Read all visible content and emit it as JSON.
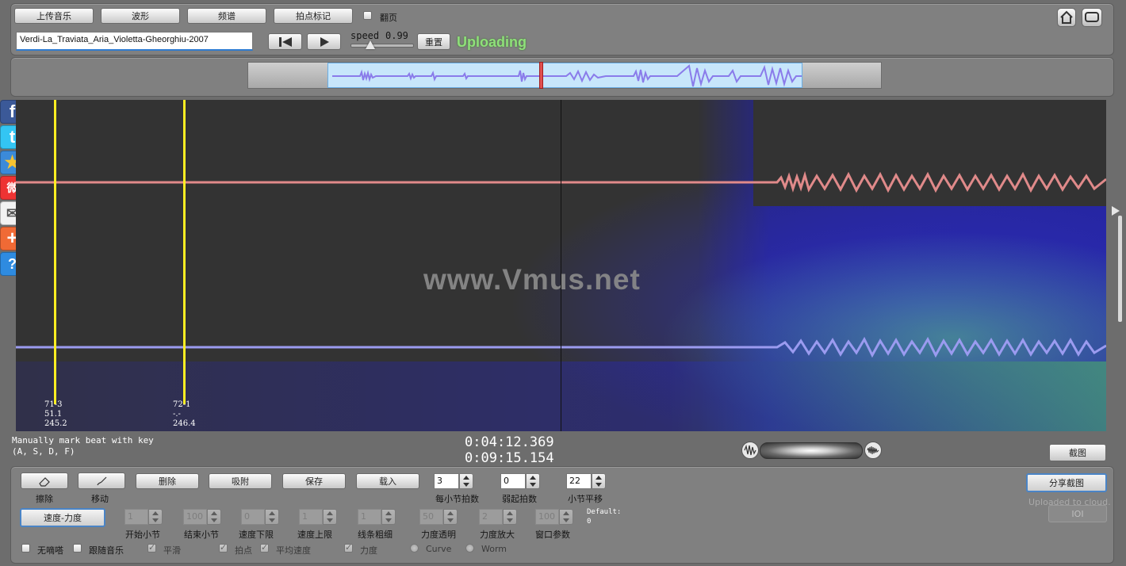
{
  "toolbar": {
    "upload_label": "上传音乐",
    "waveform_label": "波形",
    "spectrum_label": "频谱",
    "beat_mark_label": "拍点标记",
    "page_flip_label": "翻页",
    "filename": "Verdi-La_Traviata_Aria_Violetta-Gheorghiu-2007",
    "speed_label": "speed",
    "speed_value": "0.99",
    "reset_label": "重置",
    "status": "Uploading"
  },
  "watermark": "www.Vmus.net",
  "markers": [
    {
      "lines": [
        "71-3",
        "51.1",
        "245.2"
      ]
    },
    {
      "lines": [
        "72-1",
        "-.-",
        "246.4"
      ]
    }
  ],
  "hint": {
    "line1": "Manually mark beat with key",
    "line2": "(A, S, D, F)"
  },
  "time": {
    "current": "0:04:12.369",
    "total": "0:09:15.154"
  },
  "screenshot_label": "截图",
  "controls": {
    "erase_label": "擦除",
    "move_label": "移动",
    "delete_label": "删除",
    "snap_label": "吸附",
    "save_label": "保存",
    "load_label": "载入",
    "beats_per_bar": {
      "value": "3",
      "label": "每小节拍数"
    },
    "pickup_beats": {
      "value": "0",
      "label": "弱起拍数"
    },
    "bar_offset": {
      "value": "22",
      "label": "小节平移"
    },
    "share_label": "分享截图",
    "uploaded_text": "Uploaded to cloud.",
    "ioi_label": "IOI",
    "tempo_dynamics_label": "速度-力度",
    "start_bar_label": "开始小节",
    "end_bar_label": "结束小节",
    "tempo_min_label": "速度下限",
    "tempo_max_label": "速度上限",
    "line_width_label": "线条粗细",
    "dyn_opacity_label": "力度透明",
    "dyn_scale_label": "力度放大",
    "window_param_label": "窗口参数",
    "default_label": "Default:",
    "default_value": "0",
    "dim_values": [
      "1",
      "100",
      "0",
      "1",
      "1",
      "50",
      "2",
      "100"
    ],
    "no_click_label": "无嘀嗒",
    "follow_music_label": "跟随音乐",
    "smooth_label": "平滑",
    "beat_point_label": "拍点",
    "avg_tempo_label": "平均速度",
    "dynamics_label": "力度",
    "curve_label": "Curve",
    "worm_label": "Worm"
  },
  "social": [
    "f",
    "t",
    "★",
    "微",
    "✉",
    "+",
    "?"
  ],
  "colors": {
    "accent_green": "#8fe07a",
    "marker_yellow": "#ffee22",
    "waveform_pink": "#e08a8a",
    "waveform_purple": "#9b9bf0",
    "button_blue": "#4a84c6"
  }
}
